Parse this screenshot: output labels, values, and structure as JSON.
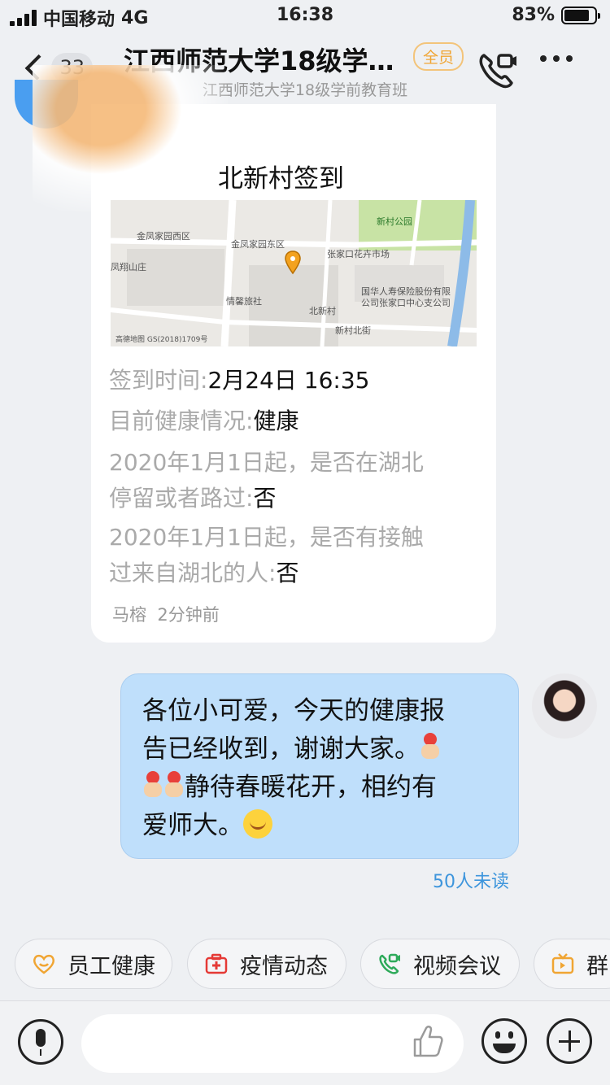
{
  "status_bar": {
    "carrier": "中国移动",
    "network": "4G",
    "time": "16:38",
    "battery": "83%",
    "battery_level": 0.83
  },
  "nav": {
    "unread_count": "33",
    "title": "江西师范大学18级学…",
    "tag": "全员",
    "subtitle": "江西师范大学18级学前教育班"
  },
  "checkin_card": {
    "title": "北新村签到",
    "map_labels": {
      "park": "新村公园",
      "west": "金凤家园西区",
      "east": "金凤家园东区",
      "market": "张家口花卉市场",
      "mountain": "凤翔山庄",
      "hotel": "情馨旅社",
      "village": "北新村",
      "insurance_1": "国华人寿保险股份有限",
      "insurance_2": "公司张家口中心支公司",
      "street": "新村北街",
      "credit": "高德地图  GS(2018)1709号"
    },
    "fields": [
      {
        "label": "签到时间:",
        "value": "2月24日 16:35"
      },
      {
        "label": "目前健康情况:",
        "value": "健康"
      },
      {
        "label_line1": "2020年1月1日起，是否在湖北",
        "label_line2": "停留或者路过:",
        "value": "否"
      },
      {
        "label_line1": "2020年1月1日起，是否有接触",
        "label_line2": "过来自湖北的人:",
        "value": "否"
      }
    ],
    "sender": "马榕",
    "sent_ago": "2分钟前"
  },
  "my_message": {
    "line1": "各位小可爱，今天的健康报",
    "line2": "告已经收到，谢谢大家。",
    "line3": "静待春暖花开，相约有",
    "line4": "爱师大。",
    "unread": "50人未读"
  },
  "quick_actions": [
    {
      "label": "员工健康",
      "icon": "heart-smile-icon",
      "color": "#f0a533"
    },
    {
      "label": "疫情动态",
      "icon": "medical-kit-icon",
      "color": "#e53935"
    },
    {
      "label": "视频会议",
      "icon": "video-call-icon",
      "color": "#2eaa5a"
    },
    {
      "label": "群",
      "icon": "tv-icon",
      "color": "#f0a533"
    }
  ],
  "input_bar": {
    "voice": "mic-icon",
    "like": "thumbs-up-icon",
    "emoji": "emoji-icon",
    "more": "plus-icon"
  }
}
